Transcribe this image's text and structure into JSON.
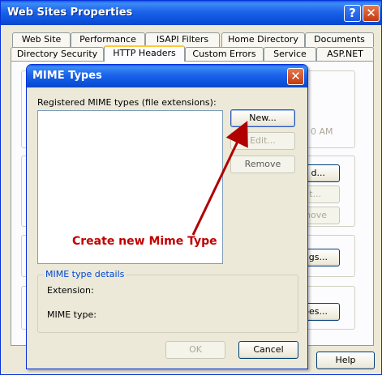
{
  "window": {
    "title": "Web Sites Properties",
    "help_glyph": "?",
    "close_glyph": "✕",
    "help_button_label": "Help"
  },
  "tabs_back": [
    "Web Site",
    "Performance",
    "ISAPI Filters",
    "Home Directory",
    "Documents"
  ],
  "tabs_front": [
    "Directory Security",
    "HTTP Headers",
    "Custom Errors",
    "Service",
    "ASP.NET"
  ],
  "active_tab": "HTTP Headers",
  "background_fragments": {
    "time_fragment": "0 AM",
    "add_fragment": "d...",
    "edit_fragment": "t...",
    "remove_fragment": "nove",
    "ratings_fragment": "ngs...",
    "types_fragment": "pes..."
  },
  "mime_dialog": {
    "title": "MIME Types",
    "close_glyph": "✕",
    "list_label": "Registered MIME types (file extensions):",
    "buttons": {
      "new": "New...",
      "edit": "Edit...",
      "remove": "Remove",
      "ok": "OK",
      "cancel": "Cancel"
    },
    "details": {
      "legend": "MIME type details",
      "extension_label": "Extension:",
      "mime_type_label": "MIME type:"
    }
  },
  "annotation": {
    "text": "Create new Mime Type",
    "color": "#c00000"
  },
  "colors": {
    "titlebar_blue": "#0a4fd8",
    "dialog_bg": "#ece9d8",
    "legend_blue": "#0046d5"
  }
}
